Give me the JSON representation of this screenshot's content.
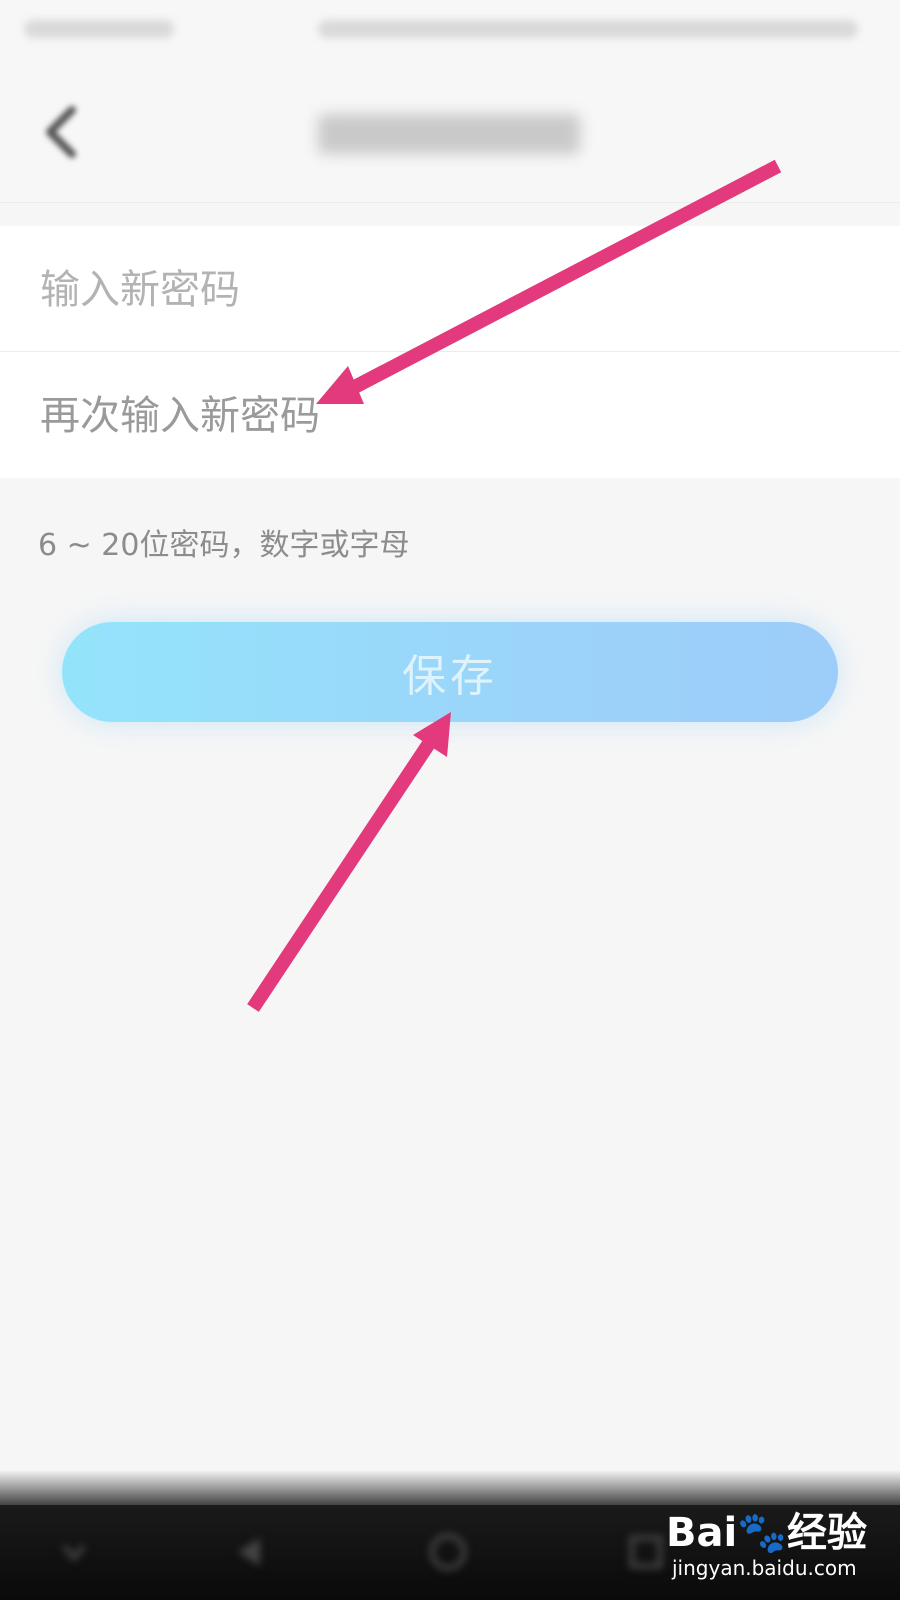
{
  "form": {
    "new_password_placeholder": "输入新密码",
    "confirm_password_placeholder": "再次输入新密码",
    "hint": "6 ~ 20位密码，数字或字母"
  },
  "save_button": {
    "label": "保存"
  },
  "colors": {
    "page_background": "#f6f6f6",
    "card_background": "#ffffff",
    "save_button_start": "#93e4fb",
    "save_button_end": "#9dcdfa",
    "annotation_arrow": "#e23a7c"
  },
  "watermark": {
    "logo": "Bai🐾经验",
    "url": "jingyan.baidu.com"
  }
}
